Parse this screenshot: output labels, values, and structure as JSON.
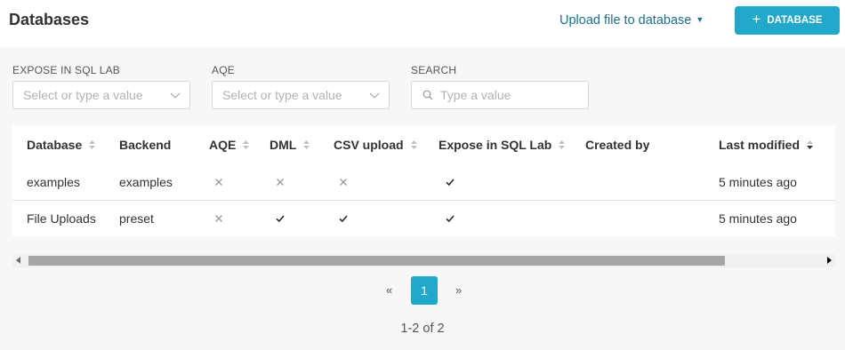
{
  "header": {
    "title": "Databases",
    "upload_label": "Upload file to database",
    "add_button_label": "DATABASE"
  },
  "filters": [
    {
      "label": "EXPOSE IN SQL LAB",
      "placeholder": "Select or type a value"
    },
    {
      "label": "AQE",
      "placeholder": "Select or type a value"
    },
    {
      "label": "SEARCH",
      "placeholder": "Type a value"
    }
  ],
  "table": {
    "columns": [
      "Database",
      "Backend",
      "AQE",
      "DML",
      "CSV upload",
      "Expose in SQL Lab",
      "Created by",
      "Last modified"
    ],
    "rows": [
      {
        "database": "examples",
        "backend": "examples",
        "aqe": false,
        "dml": false,
        "csv_upload": false,
        "expose_in_sql_lab": true,
        "created_by": "",
        "last_modified": "5 minutes ago"
      },
      {
        "database": "File Uploads",
        "backend": "preset",
        "aqe": false,
        "dml": true,
        "csv_upload": true,
        "expose_in_sql_lab": true,
        "created_by": "",
        "last_modified": "5 minutes ago"
      }
    ]
  },
  "pagination": {
    "prev": "«",
    "current": "1",
    "next": "»",
    "count_text": "1-2 of 2"
  },
  "colors": {
    "primary": "#20a7c9",
    "link": "#1b6f8e"
  }
}
